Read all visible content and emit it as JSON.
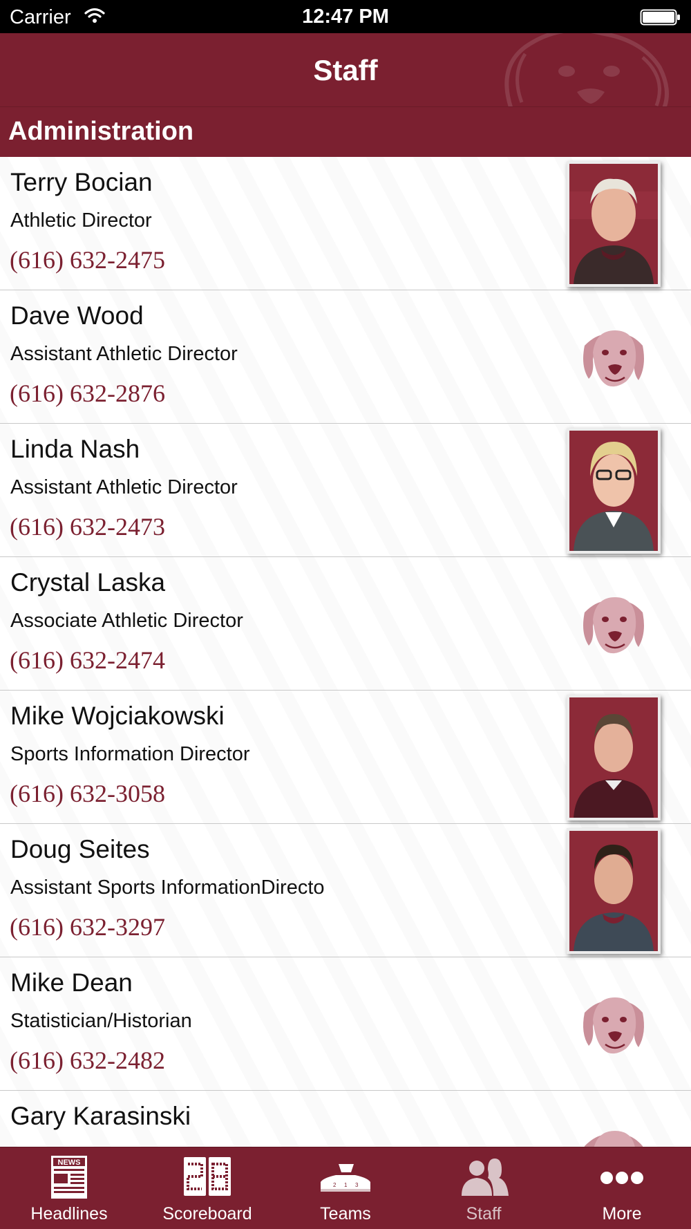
{
  "status_bar": {
    "carrier": "Carrier",
    "time": "12:47 PM",
    "wifi_icon": "wifi-icon",
    "battery_icon": "battery-icon"
  },
  "nav": {
    "title": "Staff"
  },
  "section": {
    "title": "Administration"
  },
  "staff": [
    {
      "name": "Terry Bocian",
      "title": "Athletic Director",
      "phone": "(616) 632-2475",
      "image": "photo"
    },
    {
      "name": "Dave Wood",
      "title": "Assistant Athletic Director",
      "phone": "(616) 632-2876",
      "image": "mascot-logo"
    },
    {
      "name": "Linda Nash",
      "title": "Assistant Athletic Director",
      "phone": "(616) 632-2473",
      "image": "photo"
    },
    {
      "name": "Crystal Laska",
      "title": "Associate Athletic Director",
      "phone": "(616) 632-2474",
      "image": "mascot-logo"
    },
    {
      "name": "Mike Wojciakowski",
      "title": "Sports Information Director",
      "phone": "(616) 632-3058",
      "image": "photo"
    },
    {
      "name": "Doug Seites",
      "title": "Assistant Sports InformationDirecto",
      "phone": "(616) 632-3297",
      "image": "photo"
    },
    {
      "name": "Mike Dean",
      "title": "Statistician/Historian",
      "phone": "(616) 632-2482",
      "image": "mascot-logo"
    },
    {
      "name": "Gary Karasinski",
      "title": "",
      "phone": "",
      "image": "mascot-logo"
    }
  ],
  "tabs": [
    {
      "label": "Headlines",
      "icon": "newspaper-icon",
      "active": false
    },
    {
      "label": "Scoreboard",
      "icon": "scoreboard-icon",
      "active": false
    },
    {
      "label": "Teams",
      "icon": "podium-icon",
      "active": false
    },
    {
      "label": "Staff",
      "icon": "people-icon",
      "active": true
    },
    {
      "label": "More",
      "icon": "more-dots-icon",
      "active": false
    }
  ],
  "colors": {
    "brand": "#7b2030",
    "phone_text": "#7b2030",
    "tab_active": "#d9c3c7",
    "status_bar": "#000000"
  }
}
